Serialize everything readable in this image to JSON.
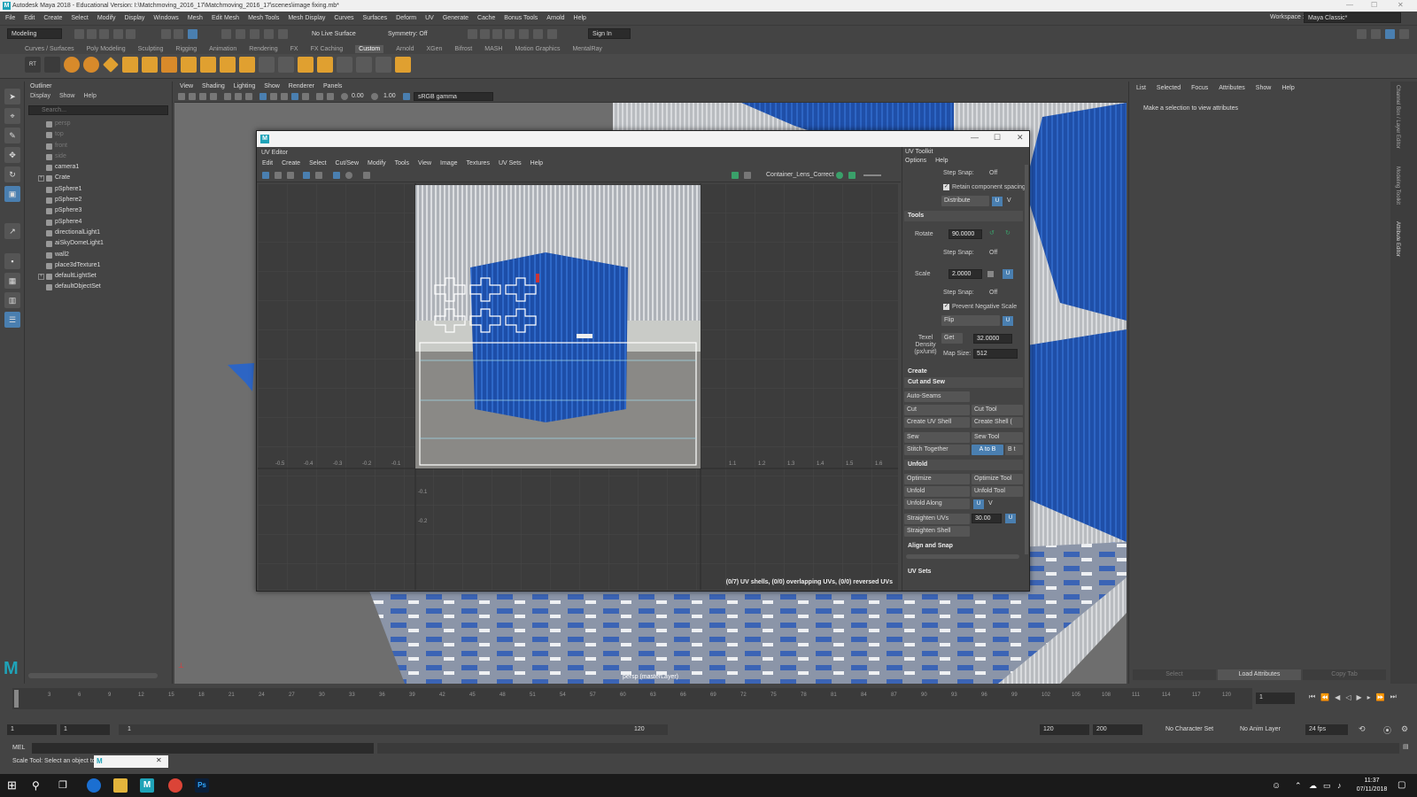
{
  "title_bar": {
    "title": "Autodesk Maya 2018 - Educational Version: I:\\Matchmoving_2016_17\\Matchmoving_2016_17\\scenes\\image fixing.mb*"
  },
  "menubar": {
    "items": [
      "File",
      "Edit",
      "Create",
      "Select",
      "Modify",
      "Display",
      "Windows",
      "Mesh",
      "Edit Mesh",
      "Mesh Tools",
      "Mesh Display",
      "Curves",
      "Surfaces",
      "Deform",
      "UV",
      "Generate",
      "Cache",
      "Bonus Tools",
      "Arnold",
      "Help"
    ],
    "workspace_label": "Workspace :",
    "workspace_value": "Maya Classic*"
  },
  "status_line": {
    "mode": "Modeling",
    "live_surface": "No Live Surface",
    "symmetry": "Symmetry: Off",
    "sign_in": "Sign In"
  },
  "shelf_tabs": [
    "Curves / Surfaces",
    "Poly Modeling",
    "Sculpting",
    "Rigging",
    "Animation",
    "Rendering",
    "FX",
    "FX Caching",
    "Custom",
    "Arnold",
    "XGen",
    "Bifrost",
    "MASH",
    "Motion Graphics",
    "MentalRay"
  ],
  "shelf_active": "Custom",
  "outliner": {
    "title": "Outliner",
    "menu": [
      "Display",
      "Show",
      "Help"
    ],
    "search_placeholder": "Search...",
    "items": [
      {
        "label": "persp",
        "dim": true
      },
      {
        "label": "top",
        "dim": true
      },
      {
        "label": "front",
        "dim": true
      },
      {
        "label": "side",
        "dim": true
      },
      {
        "label": "camera1",
        "dim": false
      },
      {
        "label": "Crate",
        "dim": false
      },
      {
        "label": "pSphere1",
        "dim": false
      },
      {
        "label": "pSphere2",
        "dim": false
      },
      {
        "label": "pSphere3",
        "dim": false
      },
      {
        "label": "pSphere4",
        "dim": false
      },
      {
        "label": "directionalLight1",
        "dim": false
      },
      {
        "label": "aiSkyDomeLight1",
        "dim": false
      },
      {
        "label": "wall2",
        "dim": false
      },
      {
        "label": "place3dTexture1",
        "dim": false
      },
      {
        "label": "defaultLightSet",
        "dim": false
      },
      {
        "label": "defaultObjectSet",
        "dim": false
      }
    ]
  },
  "viewport": {
    "menu": [
      "View",
      "Shading",
      "Lighting",
      "Show",
      "Renderer",
      "Panels"
    ],
    "field1": "0.00",
    "field2": "1.00",
    "colorspace": "sRGB gamma",
    "camera_label": "persp (masterLayer)"
  },
  "uv_editor": {
    "label": "UV Editor",
    "menu": [
      "Edit",
      "Create",
      "Select",
      "Cut/Sew",
      "Modify",
      "Tools",
      "View",
      "Image",
      "Textures",
      "UV Sets",
      "Help"
    ],
    "texture_name": "Container_Lens_Correct",
    "status": "(0/7) UV shells, (0/0) overlapping UVs, (0/0) reversed UVs",
    "axis_x_labels": [
      "-0.5",
      "-0.4",
      "-0.3",
      "-0.2",
      "-0.1",
      "1.1",
      "1.2",
      "1.3",
      "1.4",
      "1.5",
      "1.6"
    ],
    "axis_y_labels": [
      "-0.1",
      "-0.2"
    ]
  },
  "uv_toolkit": {
    "title": "UV Toolkit",
    "menu": [
      "Options",
      "Help"
    ],
    "step_snap_label": "Step Snap:",
    "off": "Off",
    "retain_spacing": "Retain component spacing",
    "distribute": "Distribute",
    "u": "U",
    "v": "V",
    "tools": "Tools",
    "rotate_label": "Rotate",
    "rotate_value": "90.0000",
    "scale_label": "Scale",
    "scale_value": "2.0000",
    "prevent_negative": "Prevent Negative Scale",
    "flip": "Flip",
    "texel_density": "Texel Density (px/unit)",
    "get": "Get",
    "texel_value": "32.0000",
    "map_size_label": "Map Size:",
    "map_size": "512",
    "create": "Create",
    "cut_and_sew": "Cut and Sew",
    "auto_seams": "Auto-Seams",
    "cut": "Cut",
    "cut_tool": "Cut Tool",
    "create_uv_shell": "Create UV Shell",
    "create_shell_tool": "Create Shell (",
    "sew": "Sew",
    "sew_tool": "Sew Tool",
    "stitch_together": "Stitch Together",
    "a_to_b": "A to B",
    "b_to": "B t",
    "unfold_section": "Unfold",
    "optimize": "Optimize",
    "optimize_tool": "Optimize Tool",
    "unfold": "Unfold",
    "unfold_tool": "Unfold Tool",
    "unfold_along": "Unfold Along",
    "straighten_uvs": "Straighten UVs",
    "straighten_value": "30.00",
    "straighten_shell": "Straighten Shell",
    "align_snap": "Align and Snap",
    "uv_sets": "UV Sets"
  },
  "attribute_editor": {
    "menu": [
      "List",
      "Selected",
      "Focus",
      "Attributes",
      "Show",
      "Help"
    ],
    "message": "Make a selection to view attributes",
    "select_btn": "Select",
    "load_btn": "Load Attributes",
    "copy_btn": "Copy Tab"
  },
  "side_tabs": [
    "Channel Box / Layer Editor",
    "Modeling Toolkit",
    "Attribute Editor"
  ],
  "timeline": {
    "ticks": [
      "3",
      "6",
      "9",
      "12",
      "15",
      "18",
      "21",
      "24",
      "27",
      "30",
      "33",
      "36",
      "39",
      "42",
      "45",
      "48",
      "51",
      "54",
      "57",
      "60",
      "63",
      "66",
      "69",
      "72",
      "75",
      "78",
      "81",
      "84",
      "87",
      "90",
      "93",
      "96",
      "99",
      "102",
      "105",
      "108",
      "111",
      "114",
      "117",
      "120"
    ],
    "current_frame": "1"
  },
  "range_slider": {
    "start": "1",
    "start2": "1",
    "inner_start": "1",
    "inner_end": "120",
    "end": "120",
    "end2": "200",
    "character_set": "No Character Set",
    "anim_layer": "No Anim Layer",
    "fps": "24 fps"
  },
  "command_line": {
    "label": "MEL"
  },
  "help_line": {
    "text": "Scale Tool: Select an object to s"
  },
  "taskbar": {
    "time": "11:37",
    "date": "07/11/2018"
  },
  "colors": {
    "accent": "#4a7fb0",
    "container_blue": "#1f4fa8",
    "maya_teal": "#1fa3b8"
  }
}
